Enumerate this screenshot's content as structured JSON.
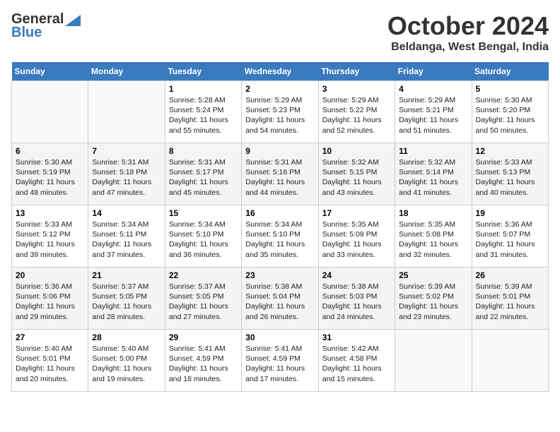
{
  "header": {
    "logo_general": "General",
    "logo_blue": "Blue",
    "month_title": "October 2024",
    "location": "Beldanga, West Bengal, India"
  },
  "calendar": {
    "days_of_week": [
      "Sunday",
      "Monday",
      "Tuesday",
      "Wednesday",
      "Thursday",
      "Friday",
      "Saturday"
    ],
    "weeks": [
      [
        {
          "day": "",
          "sunrise": "",
          "sunset": "",
          "daylight": ""
        },
        {
          "day": "",
          "sunrise": "",
          "sunset": "",
          "daylight": ""
        },
        {
          "day": "1",
          "sunrise": "Sunrise: 5:28 AM",
          "sunset": "Sunset: 5:24 PM",
          "daylight": "Daylight: 11 hours and 55 minutes."
        },
        {
          "day": "2",
          "sunrise": "Sunrise: 5:29 AM",
          "sunset": "Sunset: 5:23 PM",
          "daylight": "Daylight: 11 hours and 54 minutes."
        },
        {
          "day": "3",
          "sunrise": "Sunrise: 5:29 AM",
          "sunset": "Sunset: 5:22 PM",
          "daylight": "Daylight: 11 hours and 52 minutes."
        },
        {
          "day": "4",
          "sunrise": "Sunrise: 5:29 AM",
          "sunset": "Sunset: 5:21 PM",
          "daylight": "Daylight: 11 hours and 51 minutes."
        },
        {
          "day": "5",
          "sunrise": "Sunrise: 5:30 AM",
          "sunset": "Sunset: 5:20 PM",
          "daylight": "Daylight: 11 hours and 50 minutes."
        }
      ],
      [
        {
          "day": "6",
          "sunrise": "Sunrise: 5:30 AM",
          "sunset": "Sunset: 5:19 PM",
          "daylight": "Daylight: 11 hours and 48 minutes."
        },
        {
          "day": "7",
          "sunrise": "Sunrise: 5:31 AM",
          "sunset": "Sunset: 5:18 PM",
          "daylight": "Daylight: 11 hours and 47 minutes."
        },
        {
          "day": "8",
          "sunrise": "Sunrise: 5:31 AM",
          "sunset": "Sunset: 5:17 PM",
          "daylight": "Daylight: 11 hours and 45 minutes."
        },
        {
          "day": "9",
          "sunrise": "Sunrise: 5:31 AM",
          "sunset": "Sunset: 5:16 PM",
          "daylight": "Daylight: 11 hours and 44 minutes."
        },
        {
          "day": "10",
          "sunrise": "Sunrise: 5:32 AM",
          "sunset": "Sunset: 5:15 PM",
          "daylight": "Daylight: 11 hours and 43 minutes."
        },
        {
          "day": "11",
          "sunrise": "Sunrise: 5:32 AM",
          "sunset": "Sunset: 5:14 PM",
          "daylight": "Daylight: 11 hours and 41 minutes."
        },
        {
          "day": "12",
          "sunrise": "Sunrise: 5:33 AM",
          "sunset": "Sunset: 5:13 PM",
          "daylight": "Daylight: 11 hours and 40 minutes."
        }
      ],
      [
        {
          "day": "13",
          "sunrise": "Sunrise: 5:33 AM",
          "sunset": "Sunset: 5:12 PM",
          "daylight": "Daylight: 11 hours and 39 minutes."
        },
        {
          "day": "14",
          "sunrise": "Sunrise: 5:34 AM",
          "sunset": "Sunset: 5:11 PM",
          "daylight": "Daylight: 11 hours and 37 minutes."
        },
        {
          "day": "15",
          "sunrise": "Sunrise: 5:34 AM",
          "sunset": "Sunset: 5:10 PM",
          "daylight": "Daylight: 11 hours and 36 minutes."
        },
        {
          "day": "16",
          "sunrise": "Sunrise: 5:34 AM",
          "sunset": "Sunset: 5:10 PM",
          "daylight": "Daylight: 11 hours and 35 minutes."
        },
        {
          "day": "17",
          "sunrise": "Sunrise: 5:35 AM",
          "sunset": "Sunset: 5:09 PM",
          "daylight": "Daylight: 11 hours and 33 minutes."
        },
        {
          "day": "18",
          "sunrise": "Sunrise: 5:35 AM",
          "sunset": "Sunset: 5:08 PM",
          "daylight": "Daylight: 11 hours and 32 minutes."
        },
        {
          "day": "19",
          "sunrise": "Sunrise: 5:36 AM",
          "sunset": "Sunset: 5:07 PM",
          "daylight": "Daylight: 11 hours and 31 minutes."
        }
      ],
      [
        {
          "day": "20",
          "sunrise": "Sunrise: 5:36 AM",
          "sunset": "Sunset: 5:06 PM",
          "daylight": "Daylight: 11 hours and 29 minutes."
        },
        {
          "day": "21",
          "sunrise": "Sunrise: 5:37 AM",
          "sunset": "Sunset: 5:05 PM",
          "daylight": "Daylight: 11 hours and 28 minutes."
        },
        {
          "day": "22",
          "sunrise": "Sunrise: 5:37 AM",
          "sunset": "Sunset: 5:05 PM",
          "daylight": "Daylight: 11 hours and 27 minutes."
        },
        {
          "day": "23",
          "sunrise": "Sunrise: 5:38 AM",
          "sunset": "Sunset: 5:04 PM",
          "daylight": "Daylight: 11 hours and 26 minutes."
        },
        {
          "day": "24",
          "sunrise": "Sunrise: 5:38 AM",
          "sunset": "Sunset: 5:03 PM",
          "daylight": "Daylight: 11 hours and 24 minutes."
        },
        {
          "day": "25",
          "sunrise": "Sunrise: 5:39 AM",
          "sunset": "Sunset: 5:02 PM",
          "daylight": "Daylight: 11 hours and 23 minutes."
        },
        {
          "day": "26",
          "sunrise": "Sunrise: 5:39 AM",
          "sunset": "Sunset: 5:01 PM",
          "daylight": "Daylight: 11 hours and 22 minutes."
        }
      ],
      [
        {
          "day": "27",
          "sunrise": "Sunrise: 5:40 AM",
          "sunset": "Sunset: 5:01 PM",
          "daylight": "Daylight: 11 hours and 20 minutes."
        },
        {
          "day": "28",
          "sunrise": "Sunrise: 5:40 AM",
          "sunset": "Sunset: 5:00 PM",
          "daylight": "Daylight: 11 hours and 19 minutes."
        },
        {
          "day": "29",
          "sunrise": "Sunrise: 5:41 AM",
          "sunset": "Sunset: 4:59 PM",
          "daylight": "Daylight: 11 hours and 18 minutes."
        },
        {
          "day": "30",
          "sunrise": "Sunrise: 5:41 AM",
          "sunset": "Sunset: 4:59 PM",
          "daylight": "Daylight: 11 hours and 17 minutes."
        },
        {
          "day": "31",
          "sunrise": "Sunrise: 5:42 AM",
          "sunset": "Sunset: 4:58 PM",
          "daylight": "Daylight: 11 hours and 15 minutes."
        },
        {
          "day": "",
          "sunrise": "",
          "sunset": "",
          "daylight": ""
        },
        {
          "day": "",
          "sunrise": "",
          "sunset": "",
          "daylight": ""
        }
      ]
    ]
  }
}
